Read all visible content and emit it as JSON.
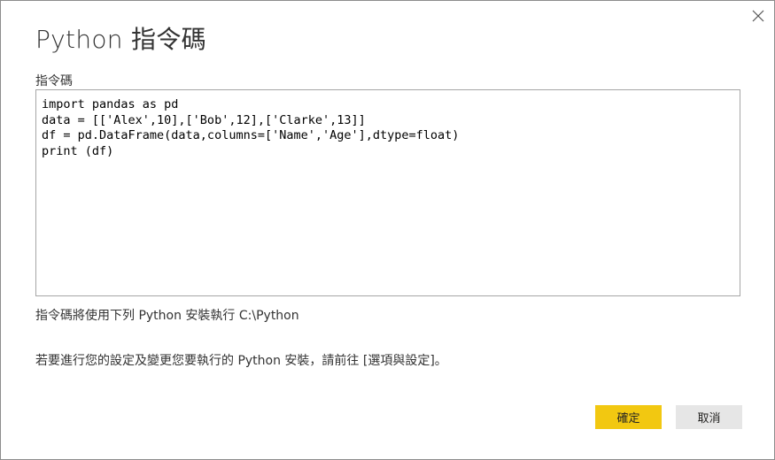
{
  "dialog": {
    "title": "Python 指令碼",
    "script_label": "指令碼",
    "script_value": "import pandas as pd\ndata = [['Alex',10],['Bob',12],['Clarke',13]]\ndf = pd.DataFrame(data,columns=['Name','Age'],dtype=float)\nprint (df)",
    "install_info": "指令碼將使用下列 Python 安裝執行 C:\\Python",
    "settings_hint": "若要進行您的設定及變更您要執行的 Python 安裝，請前往 [選項與設定]。",
    "ok_label": "確定",
    "cancel_label": "取消",
    "close_icon": "close-icon"
  },
  "colors": {
    "accent": "#f2c811",
    "secondary_button": "#e6e6e6",
    "border": "#8c8c8c"
  }
}
